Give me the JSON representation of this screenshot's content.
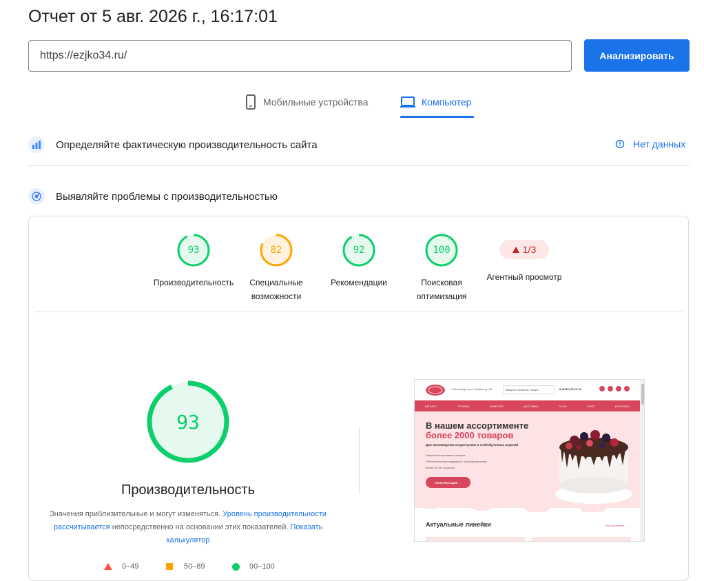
{
  "header": {
    "title": "Отчет от 5 авг. 2026 г., 16:17:01",
    "url_value": "https://ezjko34.ru/",
    "analyze_label": "Анализировать"
  },
  "tabs": {
    "mobile": "Мобильные устройства",
    "desktop": "Компьютер",
    "active": "desktop"
  },
  "field_section": {
    "title": "Определяйте фактическую производительность сайта",
    "no_data": "Нет данных"
  },
  "lab_section": {
    "title": "Выявляйте проблемы с производительностью"
  },
  "scores": [
    {
      "value": "93",
      "label": "Производительность",
      "color": "#0cce6b"
    },
    {
      "value": "82",
      "label": "Специальные возможности",
      "color": "#ffa400"
    },
    {
      "value": "92",
      "label": "Рекомендации",
      "color": "#0cce6b"
    },
    {
      "value": "100",
      "label": "Поисковая оптимизация",
      "color": "#0cce6b"
    }
  ],
  "agent": {
    "value": "1/3",
    "label": "Агентный просмотр",
    "color": "#c5221f"
  },
  "main_gauge": {
    "value": "93",
    "fraction": 0.93,
    "label": "Производительность"
  },
  "description": {
    "part1": "Значения приблизительные и могут изменяться.",
    "link1": "Уровень производительности рассчитывается",
    "part2": "непосредственно на основании этих показателей.",
    "link2": "Показать калькулятор"
  },
  "legend": {
    "fail": "0–49",
    "average": "50–89",
    "pass": "90–100"
  },
  "screenshot": {
    "address": "г. Волгоград, пр-кт Ленина, д. 48",
    "search_placeholder": "Введите название товара",
    "phone": "8 (8442) 78-12-44",
    "nav": [
      "КАТАЛОГ",
      "ОТЗЫВЫ",
      "НОВОСТИ",
      "ДОСТАВКА",
      "О НАС",
      "БЛОГ",
      "КОНТАКТЫ"
    ],
    "hero_line1": "В нашем ассортименте",
    "hero_line2": "более 2000 товаров",
    "hero_sub": "Для производства кондитерских и хлебобулочных изделий",
    "bullets": [
      "Широкий ассортимент товаров",
      "Технологическая поддержка. Быстрая доставка",
      "Более 25 лет на рынке"
    ],
    "button": "КОНСУЛЬТАЦИЯ →",
    "section_title": "Актуальные линейки",
    "all_link": "Все коллекции →"
  },
  "colors": {
    "accent": "#1a73e8",
    "pass": "#0cce6b",
    "average": "#ffa400",
    "fail": "#ff4e42",
    "site_pink": "#d7465d"
  }
}
